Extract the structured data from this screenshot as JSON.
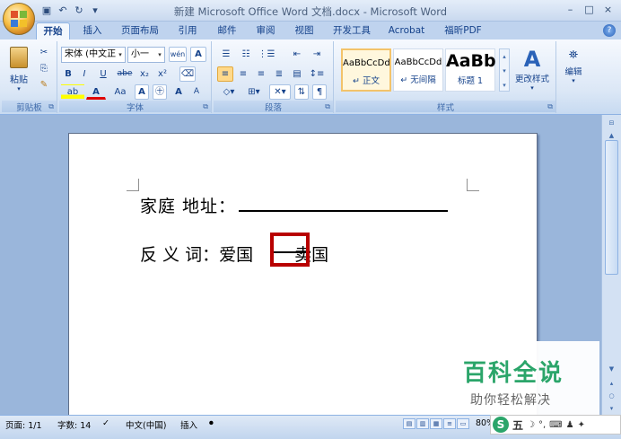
{
  "titlebar": {
    "title": "新建 Microsoft Office Word 文档.docx - Microsoft Word",
    "minimize": "–",
    "maximize": "□",
    "close": "×"
  },
  "tabs": [
    {
      "label": "开始",
      "active": true
    },
    {
      "label": "插入"
    },
    {
      "label": "页面布局"
    },
    {
      "label": "引用"
    },
    {
      "label": "邮件"
    },
    {
      "label": "审阅"
    },
    {
      "label": "视图"
    },
    {
      "label": "开发工具"
    },
    {
      "label": "Acrobat"
    },
    {
      "label": "福昕PDF"
    }
  ],
  "ribbon": {
    "clipboard": {
      "paste": "粘贴",
      "label": "剪贴板"
    },
    "font": {
      "font_name": "宋体 (中文正",
      "font_size": "小一",
      "bold": "B",
      "italic": "I",
      "underline": "U",
      "strike": "abe",
      "subscript": "x₂",
      "superscript": "x²",
      "font_color": "A",
      "change_case": "Aa",
      "grow": "A",
      "shrink": "A",
      "label": "字体"
    },
    "paragraph": {
      "label": "段落"
    },
    "styles": {
      "tiles": [
        {
          "sample": "AaBbCcDd",
          "name": "↵ 正文"
        },
        {
          "sample": "AaBbCcDd",
          "name": "↵ 无间隔"
        },
        {
          "sample": "AaBb",
          "name": "标题 1"
        }
      ],
      "change_styles": "更改样式",
      "label": "样式"
    },
    "editing": {
      "label": "编辑"
    }
  },
  "document": {
    "line1_label": "家庭 地址：",
    "line2_prefix": "反  义  词：",
    "line2_word1": "爱国",
    "line2_word2": "卖国"
  },
  "statusbar": {
    "page": "页面: 1/1",
    "words": "字数: 14",
    "language": "中文(中国)",
    "insert_mode": "插入",
    "zoom": "80%"
  },
  "watermark": {
    "title": "百科全说",
    "subtitle": "助你轻松解决"
  },
  "ime": {
    "logo": "S",
    "mode": "五"
  },
  "colors": {
    "highlight_box": "#b80000",
    "watermark_green": "#2ba56a"
  }
}
